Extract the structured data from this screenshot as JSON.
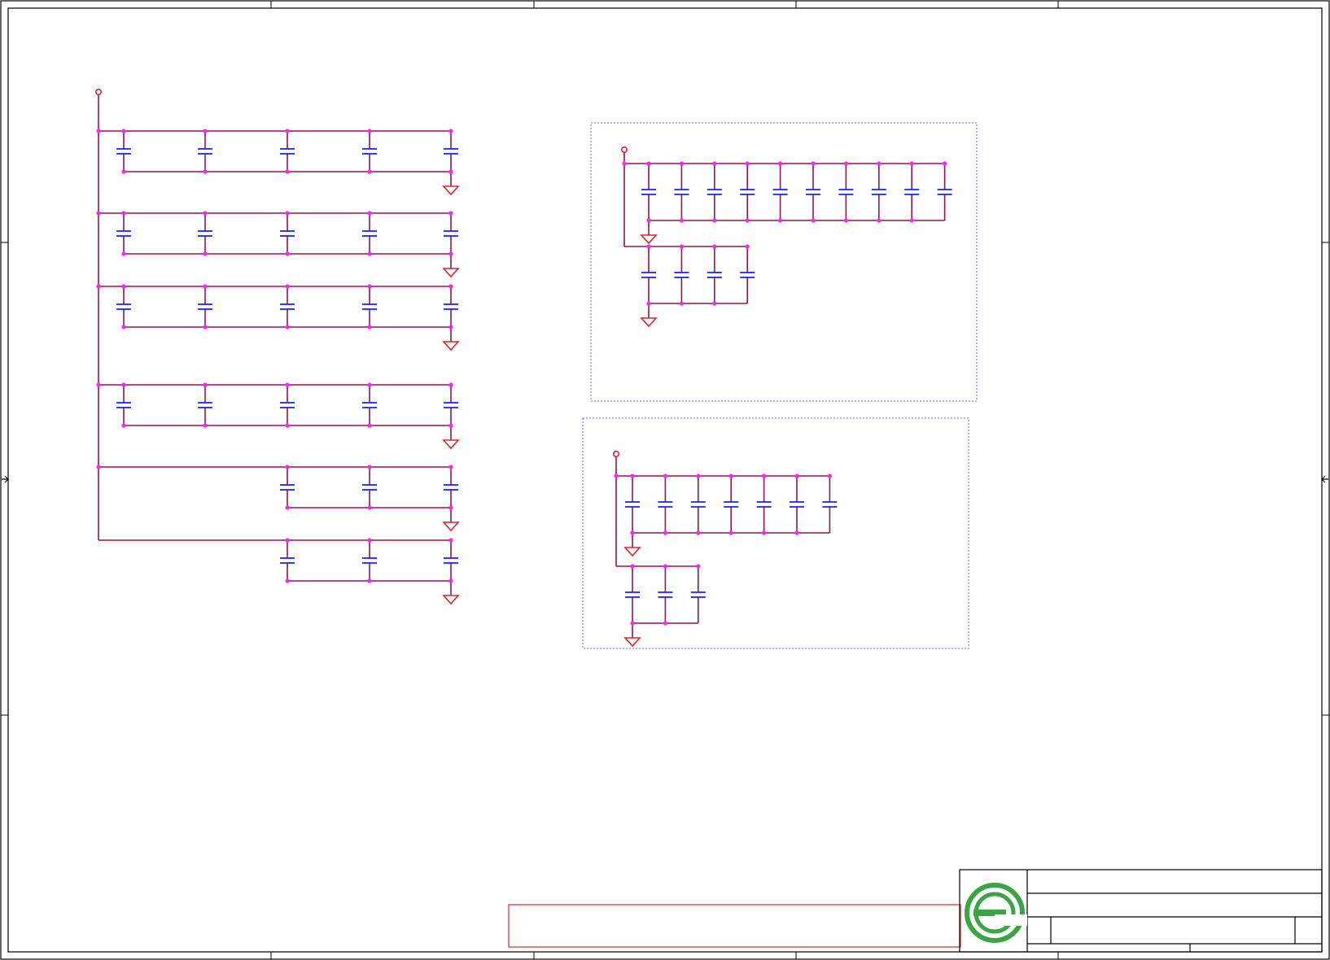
{
  "colors": {
    "wire": "#9a1050",
    "capacitor": "#1020ff",
    "junction": "#ff22ff",
    "power_ground": "#e0242c",
    "group_border": "#5a6cff",
    "logo_green": "#3aa543",
    "frame": "#000000"
  },
  "icons": {
    "capacitor": "capacitor-icon",
    "ground": "ground-icon",
    "power_port": "power-port-icon",
    "logo": "logo-icon"
  },
  "schematic": {
    "left_rails": [
      {
        "capacitors": 5,
        "ground": true
      },
      {
        "capacitors": 5,
        "ground": true
      },
      {
        "capacitors": 5,
        "ground": true
      },
      {
        "capacitors": 5,
        "ground": true
      },
      {
        "capacitors": 3,
        "ground": true
      },
      {
        "capacitors": 3,
        "ground": true
      }
    ],
    "group_a": {
      "banks": [
        {
          "capacitors": 10
        },
        {
          "capacitors": 4
        }
      ]
    },
    "group_b": {
      "banks": [
        {
          "capacitors": 7
        },
        {
          "capacitors": 3
        }
      ]
    }
  }
}
